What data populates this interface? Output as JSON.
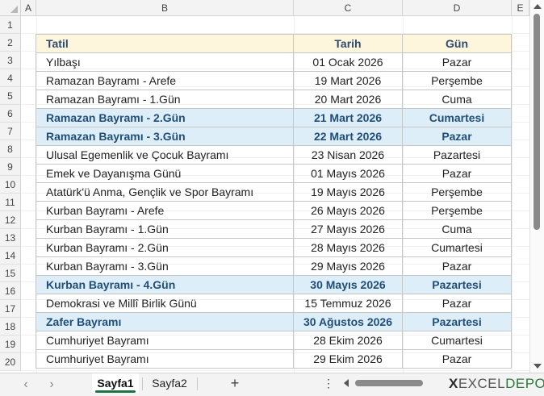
{
  "columns": [
    "A",
    "B",
    "C",
    "D",
    "E"
  ],
  "rows": [
    "1",
    "2",
    "3",
    "4",
    "5",
    "6",
    "7",
    "8",
    "9",
    "10",
    "11",
    "12",
    "13",
    "14",
    "15",
    "16",
    "17",
    "18",
    "19",
    "20"
  ],
  "table": {
    "headers": [
      "Tatil",
      "Tarih",
      "Gün"
    ],
    "rows": [
      {
        "tatil": "Yılbaşı",
        "tarih": "01 Ocak 2026",
        "gun": "Pazar",
        "highlight": false
      },
      {
        "tatil": "Ramazan Bayramı - Arefe",
        "tarih": "19 Mart 2026",
        "gun": "Perşembe",
        "highlight": false
      },
      {
        "tatil": "Ramazan Bayramı - 1.Gün",
        "tarih": "20 Mart 2026",
        "gun": "Cuma",
        "highlight": false
      },
      {
        "tatil": "Ramazan Bayramı - 2.Gün",
        "tarih": "21 Mart 2026",
        "gun": "Cumartesi",
        "highlight": true
      },
      {
        "tatil": "Ramazan Bayramı - 3.Gün",
        "tarih": "22 Mart 2026",
        "gun": "Pazar",
        "highlight": true
      },
      {
        "tatil": "Ulusal Egemenlik ve Çocuk Bayramı",
        "tarih": "23 Nisan 2026",
        "gun": "Pazartesi",
        "highlight": false
      },
      {
        "tatil": "Emek ve Dayanışma Günü",
        "tarih": "01 Mayıs 2026",
        "gun": "Pazar",
        "highlight": false
      },
      {
        "tatil": "Atatürk'ü Anma, Gençlik ve Spor Bayramı",
        "tarih": "19 Mayıs 2026",
        "gun": "Perşembe",
        "highlight": false
      },
      {
        "tatil": "Kurban Bayramı - Arefe",
        "tarih": "26 Mayıs 2026",
        "gun": "Perşembe",
        "highlight": false
      },
      {
        "tatil": "Kurban Bayramı - 1.Gün",
        "tarih": "27 Mayıs 2026",
        "gun": "Cuma",
        "highlight": false
      },
      {
        "tatil": "Kurban Bayramı - 2.Gün",
        "tarih": "28 Mayıs 2026",
        "gun": "Cumartesi",
        "highlight": false
      },
      {
        "tatil": "Kurban Bayramı - 3.Gün",
        "tarih": "29 Mayıs 2026",
        "gun": "Pazar",
        "highlight": false
      },
      {
        "tatil": "Kurban Bayramı - 4.Gün",
        "tarih": "30 Mayıs 2026",
        "gun": "Pazartesi",
        "highlight": true
      },
      {
        "tatil": "Demokrasi ve Millî Birlik Günü",
        "tarih": "15 Temmuz 2026",
        "gun": "Pazar",
        "highlight": false
      },
      {
        "tatil": "Zafer Bayramı",
        "tarih": "30 Ağustos 2026",
        "gun": "Pazartesi",
        "highlight": true
      },
      {
        "tatil": "Cumhuriyet Bayramı",
        "tarih": "28 Ekim 2026",
        "gun": "Cumartesi",
        "highlight": false
      },
      {
        "tatil": "Cumhuriyet Bayramı",
        "tarih": "29 Ekim 2026",
        "gun": "Pazar",
        "highlight": false
      }
    ]
  },
  "sheet_tabs": [
    "Sayfa1",
    "Sayfa2"
  ],
  "active_tab": "Sayfa1",
  "tab_nav": {
    "prev": "‹",
    "next": "›",
    "add": "+",
    "more": "⋮"
  },
  "logo": {
    "prefix": "X",
    "part1": "EXCEL",
    "part2": "DEPO"
  },
  "colors": {
    "header_bg": "#fdf5dc",
    "highlight_bg": "#deeef8",
    "highlight_text": "#1f4e79",
    "active_tab_underline": "#1e7145"
  }
}
